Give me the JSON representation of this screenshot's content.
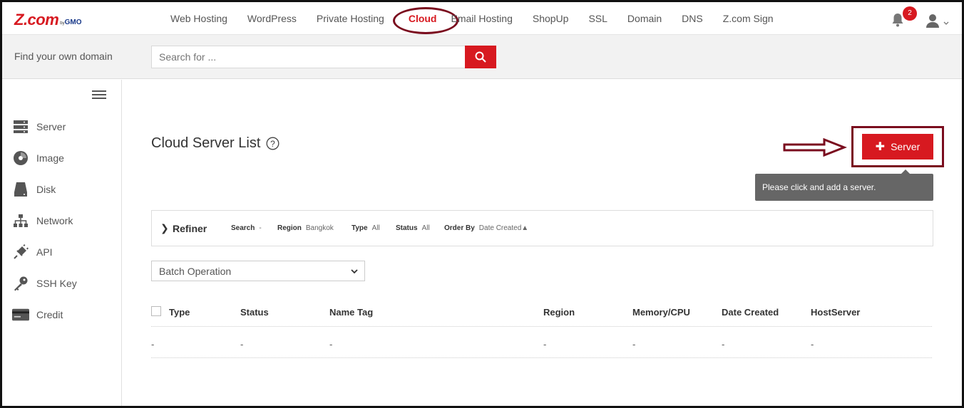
{
  "brand": {
    "logo_main": "Z.com",
    "logo_by": "by",
    "logo_gmo": "GMO"
  },
  "nav": {
    "items": [
      "Web Hosting",
      "WordPress",
      "Private Hosting",
      "Cloud",
      "Email Hosting",
      "ShopUp",
      "SSL",
      "Domain",
      "DNS",
      "Z.com Sign"
    ],
    "active": "Cloud",
    "notification_count": "2"
  },
  "search": {
    "label": "Find your own domain",
    "placeholder": "Search for ..."
  },
  "sidebar": {
    "items": [
      {
        "label": "Server",
        "icon": "server-icon"
      },
      {
        "label": "Image",
        "icon": "image-disc-icon"
      },
      {
        "label": "Disk",
        "icon": "disk-icon"
      },
      {
        "label": "Network",
        "icon": "network-icon"
      },
      {
        "label": "API",
        "icon": "api-plug-icon"
      },
      {
        "label": "SSH Key",
        "icon": "key-icon"
      },
      {
        "label": "Credit",
        "icon": "credit-card-icon"
      }
    ]
  },
  "main": {
    "title": "Cloud Server List",
    "add_server_label": "Server",
    "tooltip": "Please click and add a server.",
    "refiner": {
      "title": "Refiner",
      "search_label": "Search",
      "search_value": "-",
      "region_label": "Region",
      "region_value": "Bangkok",
      "type_label": "Type",
      "type_value": "All",
      "status_label": "Status",
      "status_value": "All",
      "order_label": "Order By",
      "order_value": "Date Created▲"
    },
    "batch_operation": "Batch Operation",
    "table": {
      "headers": [
        "Type",
        "Status",
        "Name Tag",
        "Region",
        "Memory/CPU",
        "Date Created",
        "HostServer"
      ],
      "row": [
        "-",
        "-",
        "-",
        "-",
        "-",
        "-",
        "-"
      ]
    }
  },
  "colors": {
    "accent": "#d71920",
    "annotation": "#7a0c1e",
    "tooltip_bg": "#666666"
  }
}
